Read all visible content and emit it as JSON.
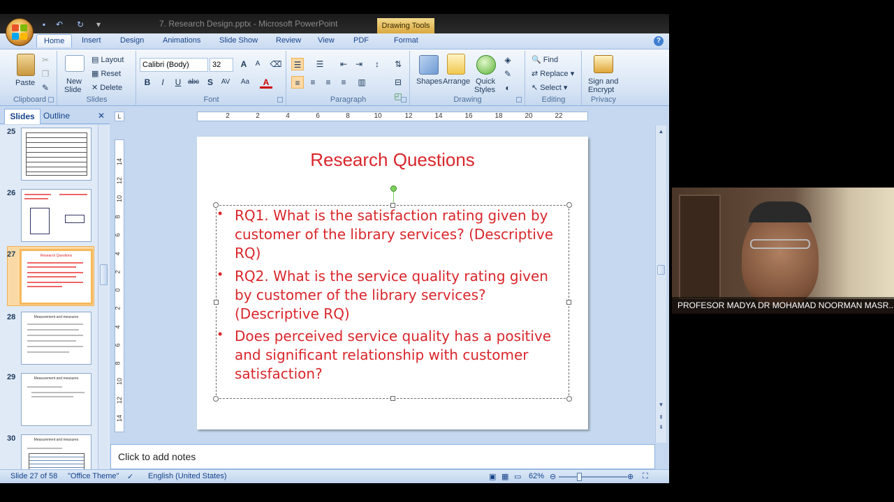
{
  "window": {
    "title": "7. Research Design.pptx - Microsoft PowerPoint",
    "contextual_tab_group": "Drawing Tools"
  },
  "ribbon_tabs": [
    {
      "label": "Home",
      "active": true
    },
    {
      "label": "Insert"
    },
    {
      "label": "Design"
    },
    {
      "label": "Animations"
    },
    {
      "label": "Slide Show"
    },
    {
      "label": "Review"
    },
    {
      "label": "View"
    },
    {
      "label": "PDF"
    },
    {
      "label": "Format"
    }
  ],
  "ribbon": {
    "clipboard": {
      "label": "Clipboard",
      "paste": "Paste"
    },
    "slides": {
      "label": "Slides",
      "new_slide_1": "New",
      "new_slide_2": "Slide",
      "layout": "Layout",
      "reset": "Reset",
      "delete": "Delete"
    },
    "font": {
      "label": "Font",
      "font_name": "Calibri (Body)",
      "font_size": "32"
    },
    "paragraph": {
      "label": "Paragraph"
    },
    "drawing": {
      "label": "Drawing",
      "shapes": "Shapes",
      "arrange": "Arrange",
      "quick_styles_1": "Quick",
      "quick_styles_2": "Styles"
    },
    "editing": {
      "label": "Editing",
      "find": "Find",
      "replace": "Replace",
      "select": "Select"
    },
    "privacy": {
      "label": "Privacy",
      "sign_1": "Sign and",
      "sign_2": "Encrypt"
    }
  },
  "left_panel": {
    "tabs": [
      "Slides",
      "Outline"
    ],
    "thumbnails": [
      {
        "number": "25",
        "title": ""
      },
      {
        "number": "26",
        "title": ""
      },
      {
        "number": "27",
        "title": "Research Questions",
        "selected": true
      },
      {
        "number": "28",
        "title": "Measurement and measures"
      },
      {
        "number": "29",
        "title": "Measurement and measures"
      },
      {
        "number": "30",
        "title": "Measurement and measures"
      }
    ]
  },
  "ruler": {
    "h_ticks": [
      "2",
      "2",
      "4",
      "6",
      "8",
      "10",
      "12",
      "14",
      "16",
      "18",
      "20",
      "22"
    ],
    "v_ticks": [
      "14",
      "12",
      "10",
      "8",
      "6",
      "4",
      "2",
      "0",
      "2",
      "4",
      "6",
      "8",
      "10",
      "12",
      "14"
    ]
  },
  "slide": {
    "title": "Research Questions",
    "bullets": [
      "RQ1. What is the satisfaction rating given by customer of the library services? (Descriptive RQ)",
      "RQ2. What is the service quality rating given by customer of the library services? (Descriptive RQ)",
      "Does perceived service quality has a positive and significant relationship with customer satisfaction?"
    ],
    "text_color": "#d9262b"
  },
  "notes": {
    "placeholder": "Click to add notes"
  },
  "status_bar": {
    "slide_info": "Slide 27 of 58",
    "theme": "\"Office Theme\"",
    "language": "English (United States)",
    "zoom": "62%"
  },
  "webcam": {
    "name": "PROFESOR MADYA DR MOHAMAD NOORMAN MASR..."
  }
}
